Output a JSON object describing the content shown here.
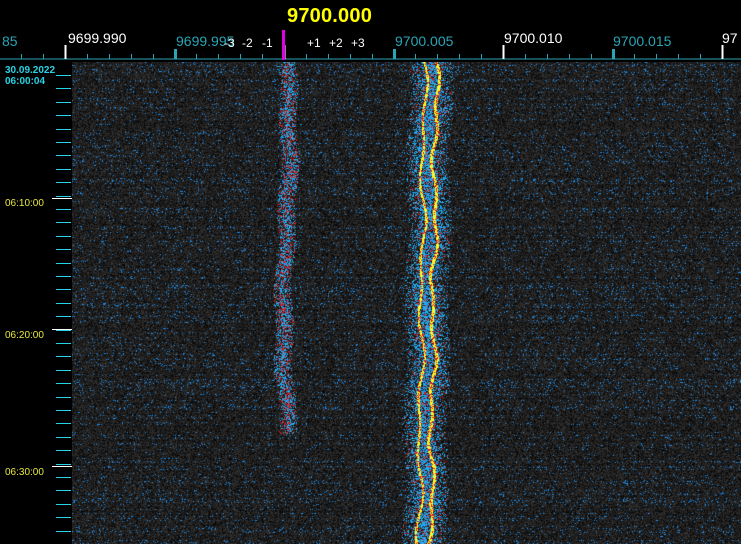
{
  "header": {
    "center_frequency": "9700.000"
  },
  "frequency_scale": {
    "labels": [
      {
        "text": "85",
        "kind": "minor"
      },
      {
        "text": "9699.990",
        "kind": "major"
      },
      {
        "text": "9699.995",
        "kind": "minor"
      },
      {
        "text": "9700.005",
        "kind": "minor"
      },
      {
        "text": "9700.010",
        "kind": "major"
      },
      {
        "text": "9700.015",
        "kind": "minor"
      },
      {
        "text": "97",
        "kind": "major"
      }
    ],
    "offset_marks": [
      "-3",
      "-2",
      "-1",
      "+1",
      "+2",
      "+3"
    ],
    "colors": {
      "major": "#ffffff",
      "minor": "#2aa5b5",
      "cursor": "#e000e0"
    }
  },
  "timeline": {
    "date": "30.09.2022",
    "start_time": "06:00:04",
    "time_marks": [
      "06:10:00",
      "06:20:00",
      "06:30:00"
    ],
    "colors": {
      "date": "#27d3e6",
      "time_marks": "#e8e840",
      "ticks": "#27d3e6"
    }
  },
  "waterfall": {
    "palette": [
      "#000000",
      "#303030",
      "#1aa0ff",
      "#d01818",
      "#ffff20"
    ]
  }
}
